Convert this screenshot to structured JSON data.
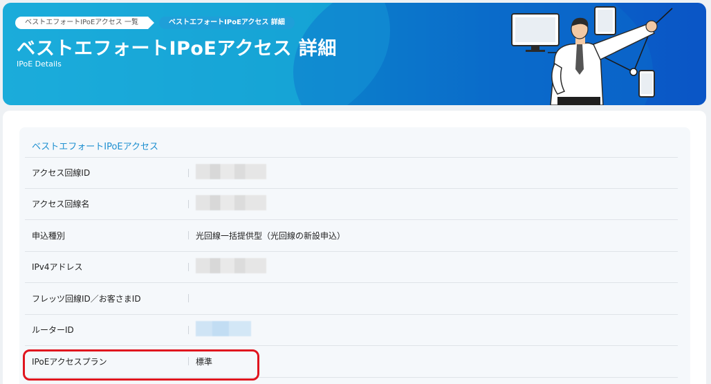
{
  "header": {
    "breadcrumb": [
      {
        "label": "ベストエフォートIPoEアクセス 一覧"
      },
      {
        "label": "ベストエフォートIPoEアクセス 詳細"
      }
    ],
    "title": "ベストエフォートIPoEアクセス 詳細",
    "subtitle": "IPoE Details"
  },
  "section": {
    "title": "ベストエフォートIPoEアクセス",
    "rows": [
      {
        "label": "アクセス回線ID",
        "value": ""
      },
      {
        "label": "アクセス回線名",
        "value": ""
      },
      {
        "label": "申込種別",
        "value": "光回線一括提供型（光回線の新設申込）"
      },
      {
        "label": "IPv4アドレス",
        "value": ""
      },
      {
        "label": "フレッツ回線ID／お客さまID",
        "value": ""
      },
      {
        "label": "ルーターID",
        "value": ""
      },
      {
        "label": "IPoEアクセスプラン",
        "value": "標準"
      }
    ]
  },
  "colors": {
    "accent": "#1d8fd0",
    "banner_start": "#1aa2d6",
    "banner_end": "#0a55c6",
    "highlight": "#e0141e"
  }
}
